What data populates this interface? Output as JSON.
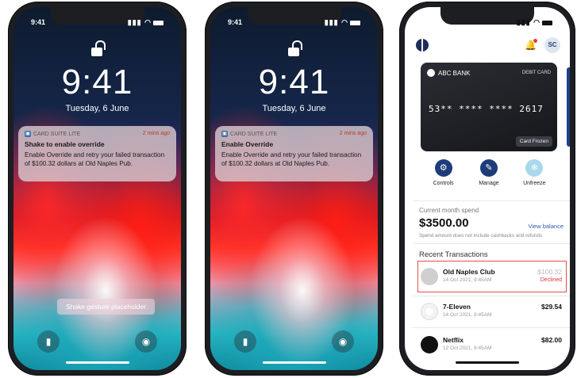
{
  "phones": [
    {
      "status_time": "9:41",
      "lock_time": "9:41",
      "date": "Tuesday, 6 June",
      "notification": {
        "app": "CARD SUITE LITE",
        "ago": "2 mins ago",
        "title": "Shake to enable override",
        "message": "Enable Override and retry your failed transaction of $100.32 dollars at Old Naples Pub."
      },
      "gesture_placeholder": "Shake gesture placeholder"
    },
    {
      "status_time": "9:41",
      "lock_time": "9:41",
      "date": "Tuesday, 6 June",
      "notification": {
        "app": "CARD SUITE LITE",
        "ago": "2 mins ago",
        "title": "Enable Override",
        "message": "Enable Override and retry your failed transaction of $100.32 dollars at Old Naples Pub."
      }
    }
  ],
  "app": {
    "avatar": "SC",
    "card": {
      "bank": "ABC BANK",
      "type": "DEBIT CARD",
      "number": "53** **** **** 2617",
      "status": "Card Frozen"
    },
    "actions": [
      {
        "label": "Controls",
        "icon": "gear-icon"
      },
      {
        "label": "Manage",
        "icon": "wrench-icon"
      },
      {
        "label": "Unfreeze",
        "icon": "snowflake-icon"
      }
    ],
    "spend": {
      "label": "Current month spend",
      "amount": "$3500.00",
      "view_balance": "View balance",
      "note": "Spend amount does not include cashbacks and refunds"
    },
    "recent_title": "Recent Transactions",
    "transactions": [
      {
        "merchant": "Old Naples Club",
        "date": "14 Oct 2021, 9:45AM",
        "amount": "$100.32",
        "status": "Declined"
      },
      {
        "merchant": "7-Eleven",
        "date": "14 Oct 2021, 9:45AM",
        "amount": "$29.54"
      },
      {
        "merchant": "Netflix",
        "date": "12 Oct 2021, 9:45AM",
        "amount": "$82.00"
      }
    ],
    "colors": {
      "accent": "#1e3c7a",
      "declined": "#d33333",
      "highlight": "#e05050"
    }
  }
}
